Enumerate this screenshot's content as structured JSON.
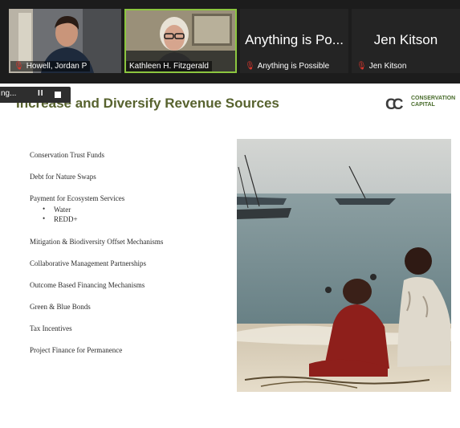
{
  "meeting": {
    "participants": [
      {
        "name": "Howell, Jordan P",
        "muted": true
      },
      {
        "name": "Kathleen H. Fitzgerald",
        "muted": false
      },
      {
        "name": "Anything is Possible",
        "display": "Anything is Po...",
        "muted": true
      },
      {
        "name": "Jen Kitson",
        "display": "Jen Kitson",
        "muted": true
      }
    ],
    "recording": {
      "label": "ng...",
      "pause_symbol": "II"
    }
  },
  "slide": {
    "title": "Increase and Diversify Revenue Sources",
    "logo": {
      "line1": "CONSERVATION",
      "line2": "CAPITAL"
    },
    "items": [
      "Conservation Trust Funds",
      "Debt for Nature Swaps",
      "Payment for Ecosystem Services",
      "Mitigation & Biodiversity Offset Mechanisms",
      "Collaborative Management Partnerships",
      "Outcome Based Financing Mechanisms",
      "Green & Blue Bonds",
      "Tax Incentives",
      "Project Finance for Permanence"
    ],
    "sub_items": [
      "Water",
      "REDD+"
    ],
    "sub_bullet": "•"
  },
  "colors": {
    "title": "#57622e",
    "active_speaker": "#8cc63f",
    "mic_muted": "#e0362c"
  },
  "icons": [
    "mic-muted-icon",
    "pause-icon",
    "stop-icon",
    "conservation-capital-logo"
  ]
}
